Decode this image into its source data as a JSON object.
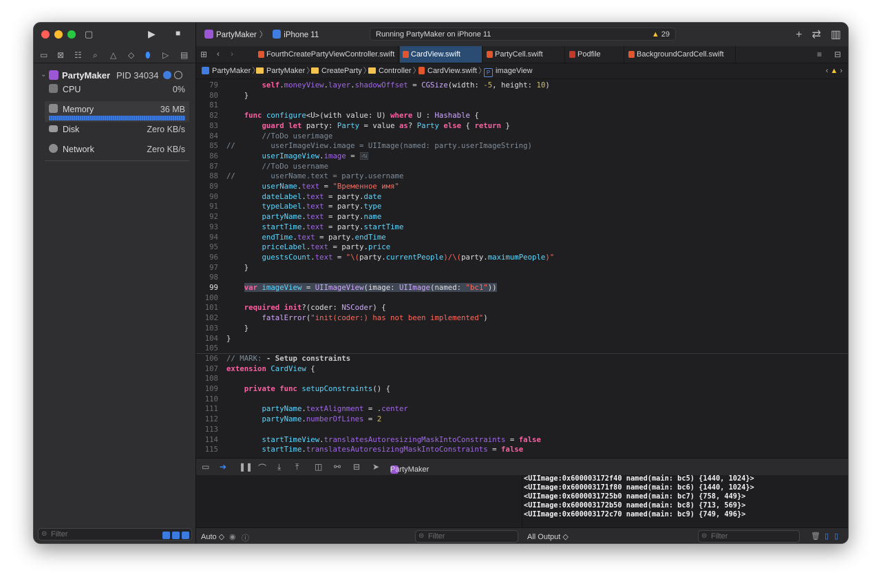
{
  "window": {
    "scheme_app": "PartyMaker",
    "scheme_device": "iPhone 11",
    "status_text": "Running PartyMaker on iPhone 11",
    "warning_count": "29"
  },
  "tabs": [
    {
      "label": "FourthCreatePartyViewController.swift"
    },
    {
      "label": "CardView.swift"
    },
    {
      "label": "PartyCell.swift"
    },
    {
      "label": "Podfile"
    },
    {
      "label": "BackgroundCardCell.swift"
    }
  ],
  "breadcrumbs": [
    "PartyMaker",
    "PartyMaker",
    "CreateParty",
    "Controller",
    "CardView.swift",
    "imageView"
  ],
  "sidebar": {
    "process_name": "PartyMaker",
    "process_pid": "PID 34034",
    "gauges": [
      {
        "name": "CPU",
        "value": "0%"
      },
      {
        "name": "Memory",
        "value": "36 MB"
      },
      {
        "name": "Disk",
        "value": "Zero KB/s"
      },
      {
        "name": "Network",
        "value": "Zero KB/s"
      }
    ],
    "filter_placeholder": "Filter"
  },
  "code": [
    {
      "n": "79",
      "html": "        <span class='kw'>self</span>.<span class='pr'>moneyView</span>.<span class='pr'>layer</span>.<span class='pr'>shadowOffset</span> = <span class='ty'>CGSize</span>(width: <span class='nm'>-5</span>, height: <span class='nm'>10</span>)"
    },
    {
      "n": "80",
      "html": "    }"
    },
    {
      "n": "81",
      "html": ""
    },
    {
      "n": "82",
      "html": "    <span class='kw'>func</span> <span class='df'>configure</span>&lt;U&gt;(with value: U) <span class='kw'>where</span> U : <span class='ty'>Hashable</span> {"
    },
    {
      "n": "83",
      "html": "        <span class='kw'>guard let</span> party: <span class='df'>Party</span> = value <span class='kw'>as</span>? <span class='df'>Party</span> <span class='kw'>else</span> { <span class='kw'>return</span> }"
    },
    {
      "n": "84",
      "html": "        <span class='cm'>//ToDo userimage</span>"
    },
    {
      "n": "85",
      "html": "<span class='cm'>//        userImageView.image = UIImage(named: party.userImageString)</span>"
    },
    {
      "n": "86",
      "html": "        <span class='df'>userImageView</span>.<span class='pr'>image</span> = <span class='cm'>&#x1F5BC;</span>"
    },
    {
      "n": "87",
      "html": "        <span class='cm'>//ToDo username</span>"
    },
    {
      "n": "88",
      "html": "<span class='cm'>//        userName.text = party.username</span>"
    },
    {
      "n": "89",
      "html": "        <span class='df'>userName</span>.<span class='pr'>text</span> = <span class='st'>\"Временное имя\"</span>"
    },
    {
      "n": "90",
      "html": "        <span class='df'>dateLabel</span>.<span class='pr'>text</span> = party.<span class='df'>date</span>"
    },
    {
      "n": "91",
      "html": "        <span class='df'>typeLabel</span>.<span class='pr'>text</span> = party.<span class='df'>type</span>"
    },
    {
      "n": "92",
      "html": "        <span class='df'>partyName</span>.<span class='pr'>text</span> = party.<span class='df'>name</span>"
    },
    {
      "n": "93",
      "html": "        <span class='df'>startTime</span>.<span class='pr'>text</span> = party.<span class='df'>startTime</span>"
    },
    {
      "n": "94",
      "html": "        <span class='df'>endTime</span>.<span class='pr'>text</span> = party.<span class='df'>endTime</span>"
    },
    {
      "n": "95",
      "html": "        <span class='df'>priceLabel</span>.<span class='pr'>text</span> = party.<span class='df'>price</span>"
    },
    {
      "n": "96",
      "html": "        <span class='df'>guestsCount</span>.<span class='pr'>text</span> = <span class='st'>\"\\(</span>party.<span class='df'>currentPeople</span><span class='st'>)/\\(</span>party.<span class='df'>maximumPeople</span><span class='st'>)\"</span>"
    },
    {
      "n": "97",
      "html": "    }"
    },
    {
      "n": "98",
      "html": ""
    },
    {
      "n": "99",
      "html": "    <span class='sel'><span class='kw'>var</span> <span class='df'>imageView</span> = <span class='ty'>UIImageView</span>(image: <span class='ty'>UIImage</span>(named: <span class='st'>\"bc1\"</span>))</span>",
      "selected": true
    },
    {
      "n": "100",
      "html": ""
    },
    {
      "n": "101",
      "html": "    <span class='kw'>required</span> <span class='kw'>init</span>?(coder: <span class='ty'>NSCoder</span>) {"
    },
    {
      "n": "102",
      "html": "        <span class='ty'>fatalError</span>(<span class='st'>\"init(coder:) has not been implemented\"</span>)"
    },
    {
      "n": "103",
      "html": "    }"
    },
    {
      "n": "104",
      "html": "}"
    },
    {
      "n": "105",
      "html": "",
      "divider": true
    },
    {
      "n": "106",
      "html": "<span class='cm'>// MARK: </span><span style='color:#c9c9cb;font-weight:bold'>- Setup constraints</span>"
    },
    {
      "n": "107",
      "html": "<span class='kw'>extension</span> <span class='df'>CardView</span> {"
    },
    {
      "n": "108",
      "html": ""
    },
    {
      "n": "109",
      "html": "    <span class='kw'>private func</span> <span class='df'>setupConstraints</span>() {"
    },
    {
      "n": "110",
      "html": ""
    },
    {
      "n": "111",
      "html": "        <span class='df'>partyName</span>.<span class='pr'>textAlignment</span> = .<span class='pr'>center</span>"
    },
    {
      "n": "112",
      "html": "        <span class='df'>partyName</span>.<span class='pr'>numberOfLines</span> = <span class='nm'>2</span>"
    },
    {
      "n": "113",
      "html": ""
    },
    {
      "n": "114",
      "html": "        <span class='df'>startTimeView</span>.<span class='pr'>translatesAutoresizingMaskIntoConstraints</span> = <span class='kw'>false</span>"
    },
    {
      "n": "115",
      "html": "        <span class='df'>startTime</span>.<span class='pr'>translatesAutoresizingMaskIntoConstraints</span> = <span class='kw'>false</span>"
    }
  ],
  "console": [
    "<UIImage:0x600003172f40 named(main: bc5) {1440, 1024}>",
    "<UIImage:0x600003171f80 named(main: bc6) {1440, 1024}>",
    "<UIImage:0x6000031725b0 named(main: bc7) {758, 449}>",
    "<UIImage:0x600003172b50 named(main: bc8) {713, 569}>",
    "<UIImage:0x600003172c70 named(main: bc9) {749, 496}>"
  ],
  "debug": {
    "target": "PartyMaker",
    "left_mode": "Auto ◇",
    "filter_placeholder": "Filter",
    "output_mode": "All Output ◇"
  }
}
